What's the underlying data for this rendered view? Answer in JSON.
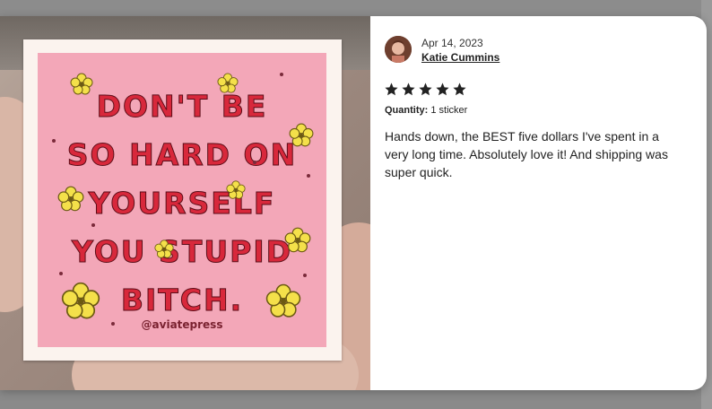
{
  "review": {
    "date": "Apr 14, 2023",
    "reviewer_name": "Katie Cummins",
    "rating": 5,
    "rating_max": 5,
    "quantity_label": "Quantity:",
    "quantity_value": "1 sticker",
    "text": "Hands down, the BEST five dollars I've spent in a very long time. Absolutely love it! And shipping was super quick."
  },
  "photo": {
    "sticker_lines": [
      "DON'T BE",
      "SO HARD ON",
      "YOURSELF",
      "YOU STUPID",
      "BITCH."
    ],
    "sticker_handle": "@aviatepress"
  },
  "icons": {
    "star": "star-icon",
    "avatar": "avatar"
  },
  "colors": {
    "star": "#222222",
    "sticker_pink": "#f3a7b8",
    "sticker_text": "#d8283b",
    "flower": "#f4e04a"
  }
}
